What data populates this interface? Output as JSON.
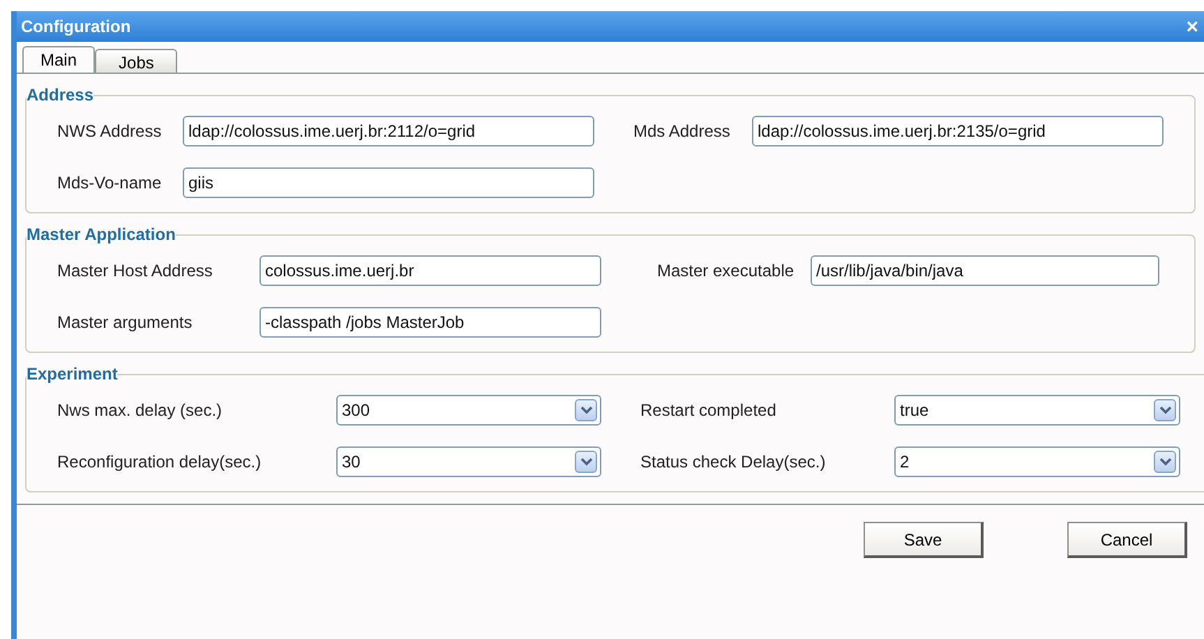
{
  "window": {
    "title": "Configuration",
    "close": "×"
  },
  "tabs": [
    {
      "label": "Main",
      "selected": true
    },
    {
      "label": "Jobs",
      "selected": false
    }
  ],
  "sections": [
    {
      "title": "Address",
      "rows": [
        [
          {
            "kind": "text",
            "label": "NWS Address",
            "value": "ldap://colossus.ime.uerj.br:2112/o=grid"
          },
          {
            "kind": "text",
            "label": "Mds Address",
            "value": "ldap://colossus.ime.uerj.br:2135/o=grid"
          }
        ],
        [
          {
            "kind": "text",
            "label": "Mds-Vo-name",
            "value": "giis"
          }
        ]
      ]
    },
    {
      "title": "Master Application",
      "rows": [
        [
          {
            "kind": "text",
            "label": "Master Host Address",
            "value": "colossus.ime.uerj.br"
          },
          {
            "kind": "text",
            "label": "Master executable",
            "value": "/usr/lib/java/bin/java"
          }
        ],
        [
          {
            "kind": "text",
            "label": "Master arguments",
            "value": "-classpath /jobs MasterJob"
          }
        ]
      ]
    },
    {
      "title": "Experiment",
      "rows": [
        [
          {
            "kind": "select",
            "label": "Nws max. delay (sec.)",
            "value": "300"
          },
          {
            "kind": "select",
            "label": "Restart completed",
            "value": "true"
          }
        ],
        [
          {
            "kind": "select",
            "label": "Reconfiguration delay(sec.)",
            "value": "30"
          },
          {
            "kind": "select",
            "label": "Status check Delay(sec.)",
            "value": "2"
          }
        ]
      ]
    }
  ],
  "buttons": [
    "Save",
    "Cancel"
  ]
}
